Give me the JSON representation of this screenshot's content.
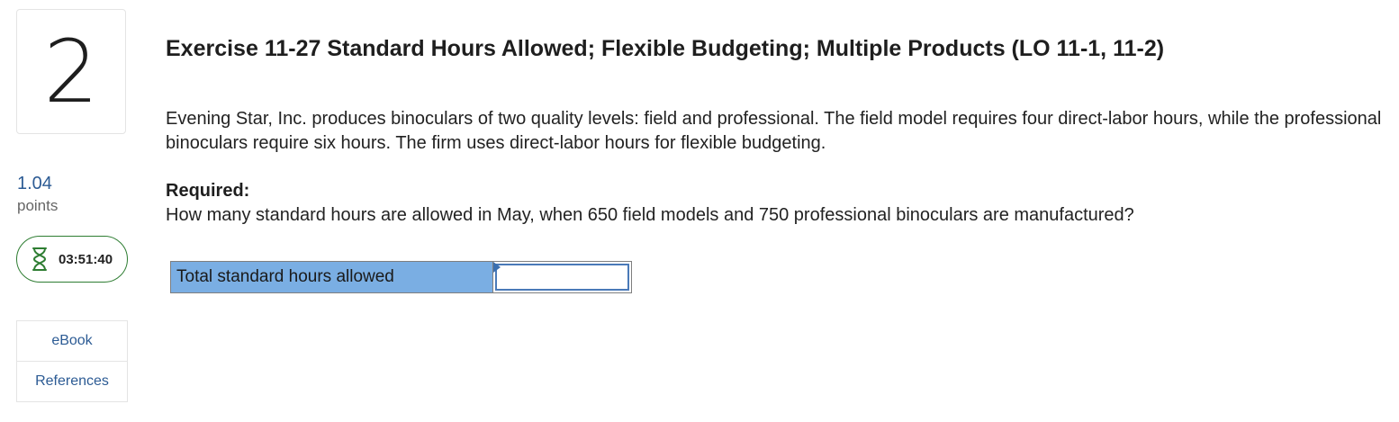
{
  "question": {
    "number": "2",
    "points_value": "1.04",
    "points_label": "points",
    "timer": "03:51:40"
  },
  "resources": {
    "ebook_label": "eBook",
    "references_label": "References"
  },
  "exercise": {
    "title": "Exercise 11-27 Standard Hours Allowed; Flexible Budgeting; Multiple Products (LO 11-1, 11-2)",
    "intro": "Evening Star, Inc. produces binoculars of two quality levels: field and professional. The field model requires four direct-labor hours, while the professional binoculars require six hours. The firm uses direct-labor hours for flexible budgeting.",
    "required_label": "Required:",
    "question_text": "How many standard hours are allowed in May, when 650 field models and 750 professional binoculars are manufactured?"
  },
  "answer_table": {
    "row_label": "Total standard hours allowed",
    "input_value": "",
    "input_placeholder": ""
  },
  "colors": {
    "accent_blue": "#2c5b94",
    "label_cell_bg": "#7aaee3",
    "timer_border": "#2e7d32"
  }
}
